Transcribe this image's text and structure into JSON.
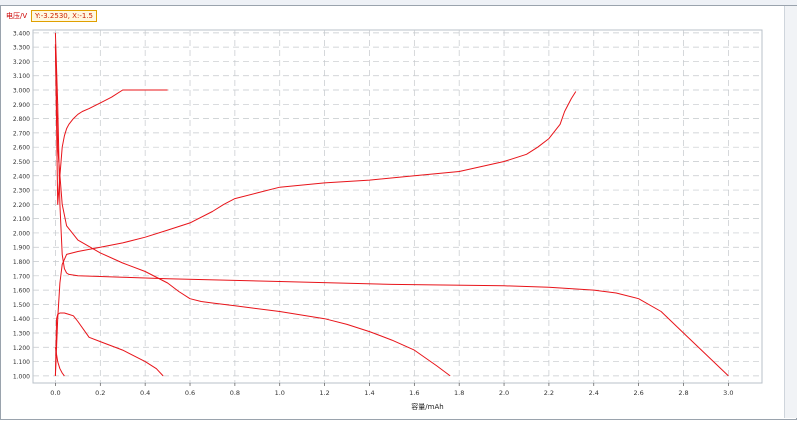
{
  "chart_data": {
    "type": "line",
    "xlabel": "容量/mAh",
    "ylabel": "电压/V",
    "xlim": [
      -0.1,
      3.15
    ],
    "ylim": [
      0.95,
      3.42
    ],
    "x_ticks": [
      "0.0",
      "0.2",
      "0.4",
      "0.6",
      "0.8",
      "1.0",
      "1.2",
      "1.4",
      "1.6",
      "1.8",
      "2.0",
      "2.2",
      "2.4",
      "2.6",
      "2.8",
      "3.0"
    ],
    "x_tick_values": [
      0.0,
      0.2,
      0.4,
      0.6,
      0.8,
      1.0,
      1.2,
      1.4,
      1.6,
      1.8,
      2.0,
      2.2,
      2.4,
      2.6,
      2.8,
      3.0
    ],
    "y_ticks": [
      "1.000",
      "1.100",
      "1.200",
      "1.300",
      "1.400",
      "1.500",
      "1.600",
      "1.700",
      "1.800",
      "1.900",
      "2.000",
      "2.100",
      "2.200",
      "2.300",
      "2.400",
      "2.500",
      "2.600",
      "2.700",
      "2.800",
      "2.900",
      "3.000",
      "3.100",
      "3.200",
      "3.300",
      "3.400"
    ],
    "y_tick_values": [
      1.0,
      1.1,
      1.2,
      1.3,
      1.4,
      1.5,
      1.6,
      1.7,
      1.8,
      1.9,
      2.0,
      2.1,
      2.2,
      2.3,
      2.4,
      2.5,
      2.6,
      2.7,
      2.8,
      2.9,
      3.0,
      3.1,
      3.2,
      3.3,
      3.4
    ],
    "grid": true,
    "marker_text": "Y:-3.2530, X:-1.5",
    "line_color": "#e8141a",
    "series": [
      {
        "x": [
          0.0,
          0.01,
          0.02,
          0.03,
          0.04,
          0.05,
          0.06,
          0.08,
          0.1,
          0.12,
          0.15,
          0.2,
          0.25,
          0.3,
          0.32,
          0.35,
          0.4,
          0.45,
          0.5
        ],
        "y": [
          3.32,
          2.2,
          2.4,
          2.6,
          2.68,
          2.73,
          2.76,
          2.8,
          2.83,
          2.85,
          2.87,
          2.91,
          2.95,
          3.0,
          3.0,
          3.0,
          3.0,
          3.0,
          3.0
        ]
      },
      {
        "x": [
          0.0,
          0.01,
          0.02,
          0.03,
          0.05,
          0.1,
          0.2,
          0.3,
          0.4,
          0.5,
          0.6,
          0.7,
          0.75,
          0.8,
          0.9,
          1.0,
          1.2,
          1.4,
          1.6,
          1.8,
          2.0,
          2.1,
          2.15,
          2.2,
          2.25,
          2.27,
          2.3,
          2.32
        ],
        "y": [
          1.0,
          1.4,
          1.65,
          1.78,
          1.85,
          1.87,
          1.9,
          1.93,
          1.97,
          2.02,
          2.07,
          2.15,
          2.2,
          2.24,
          2.28,
          2.32,
          2.35,
          2.37,
          2.4,
          2.43,
          2.5,
          2.55,
          2.6,
          2.66,
          2.76,
          2.85,
          2.94,
          2.99
        ]
      },
      {
        "x": [
          0.0,
          0.01,
          0.02,
          0.03,
          0.04,
          0.05,
          0.06,
          0.1,
          0.3,
          0.5,
          1.0,
          1.5,
          2.0,
          2.2,
          2.4,
          2.5,
          2.6,
          2.7,
          2.8,
          2.9,
          3.0
        ],
        "y": [
          3.4,
          2.9,
          2.2,
          1.85,
          1.75,
          1.72,
          1.71,
          1.7,
          1.69,
          1.68,
          1.66,
          1.64,
          1.63,
          1.62,
          1.6,
          1.58,
          1.54,
          1.45,
          1.3,
          1.15,
          1.0
        ]
      },
      {
        "x": [
          0.0,
          0.01,
          0.03,
          0.05,
          0.1,
          0.2,
          0.3,
          0.4,
          0.5,
          0.55,
          0.6,
          0.65,
          0.7,
          0.8,
          1.0,
          1.2,
          1.3,
          1.4,
          1.5,
          1.6,
          1.7,
          1.76
        ],
        "y": [
          3.3,
          2.6,
          2.2,
          2.05,
          1.95,
          1.86,
          1.79,
          1.73,
          1.65,
          1.59,
          1.54,
          1.52,
          1.51,
          1.49,
          1.45,
          1.4,
          1.36,
          1.31,
          1.25,
          1.18,
          1.07,
          1.0
        ]
      },
      {
        "x": [
          0.0,
          0.005,
          0.01,
          0.02,
          0.04,
          0.06,
          0.08,
          0.1,
          0.15,
          0.2,
          0.3,
          0.4,
          0.45,
          0.48
        ],
        "y": [
          1.0,
          1.4,
          1.43,
          1.44,
          1.44,
          1.43,
          1.42,
          1.38,
          1.27,
          1.24,
          1.18,
          1.1,
          1.05,
          1.0
        ]
      },
      {
        "x": [
          0.0,
          0.01,
          0.02,
          0.03,
          0.04
        ],
        "y": [
          1.2,
          1.1,
          1.05,
          1.02,
          1.0
        ]
      }
    ]
  }
}
